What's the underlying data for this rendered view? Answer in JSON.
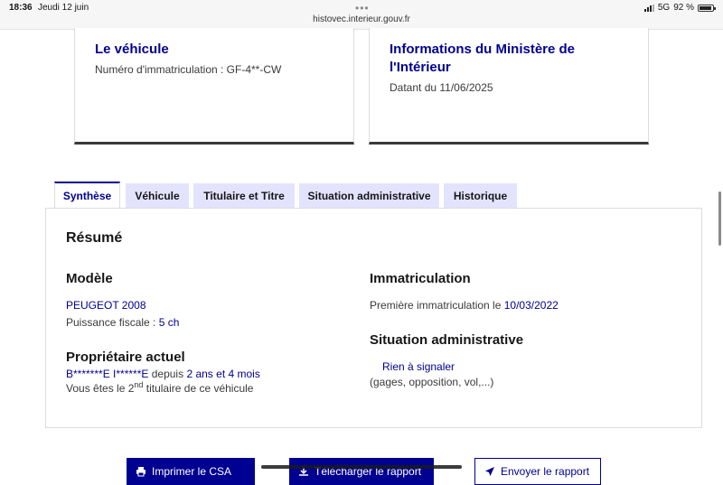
{
  "statusbar": {
    "time": "18:36",
    "date": "Jeudi 12 juin",
    "url": "histovec.interieur.gouv.fr",
    "network": "5G",
    "battery": "92 %",
    "dots": "•••"
  },
  "cards": {
    "vehicle": {
      "title": "Le véhicule",
      "plate_label": "Numéro d'immatriculation : GF-4**-CW"
    },
    "ministry": {
      "title": "Informations du Ministère de l'Intérieur",
      "date_label": "Datant du 11/06/2025"
    }
  },
  "tabs": [
    "Synthèse",
    "Véhicule",
    "Titulaire et Titre",
    "Situation administrative",
    "Historique"
  ],
  "summary": {
    "heading": "Résumé",
    "model": {
      "heading": "Modèle",
      "name": "PEUGEOT 2008",
      "power_label": "Puissance fiscale :",
      "power_value": "5 ch"
    },
    "owner": {
      "heading": "Propriétaire actuel",
      "name": "B*******E I******E",
      "since_prefix": "depuis",
      "since_value": "2 ans et 4 mois",
      "rank_prefix": "Vous êtes le 2",
      "rank_sup": "nd",
      "rank_suffix": "titulaire de ce véhicule"
    },
    "registration": {
      "heading": "Immatriculation",
      "first_label": "Première immatriculation le",
      "first_value": "10/03/2022"
    },
    "admin": {
      "heading": "Situation administrative",
      "status": "Rien à signaler",
      "details": "(gages, opposition, vol,...)"
    }
  },
  "actions": {
    "print": "Imprimer le CSA",
    "download": "Télécharger le rapport",
    "send": "Envoyer le rapport"
  }
}
